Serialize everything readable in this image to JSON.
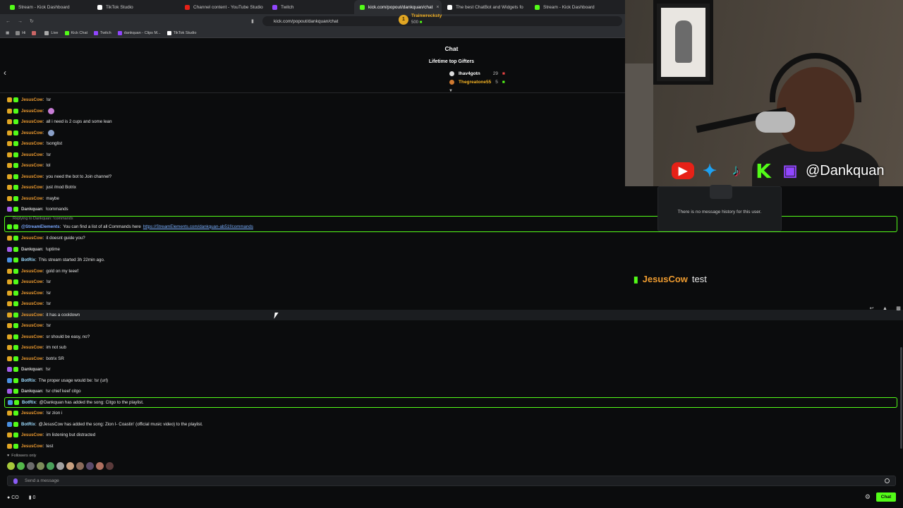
{
  "browser": {
    "tabs": [
      {
        "label": "Stream - Kick Dashboard",
        "color": "#53fc18",
        "active": false
      },
      {
        "label": "TikTok Studio",
        "color": "#ffffff",
        "active": false
      },
      {
        "label": "Channel content - YouTube Studio",
        "color": "#e62117",
        "active": false
      },
      {
        "label": "Twitch",
        "color": "#9146ff",
        "active": false
      },
      {
        "label": "kick.com/popout/dankquan/chat",
        "color": "#53fc18",
        "active": true
      },
      {
        "label": "The best ChatBot and Widgets fo",
        "color": "#ffffff",
        "active": false
      },
      {
        "label": "Stream - Kick Dashboard",
        "color": "#53fc18",
        "active": false
      }
    ],
    "url": "kick.com/popout/dankquan/chat",
    "bookmarks": [
      {
        "label": "Hi",
        "color": "#888"
      },
      {
        "label": "",
        "color": "#c66"
      },
      {
        "label": "Live",
        "color": "#aaa"
      },
      {
        "label": "Kick Chat",
        "color": "#53fc18"
      },
      {
        "label": "Twitch",
        "color": "#9146ff"
      },
      {
        "label": "dankquan - Clips M...",
        "color": "#9146ff"
      },
      {
        "label": "TikTok Studio",
        "color": "#ffffff"
      }
    ]
  },
  "chat": {
    "title": "Chat",
    "gifters_title": "Lifetime top Gifters",
    "top_gifter": {
      "rank": "1",
      "name": "Trainwrecksty",
      "count": "500"
    },
    "gifters": [
      {
        "name": "Ihav4gotn",
        "count": "29",
        "color": "#ffffff"
      },
      {
        "name": "Thegreatone55",
        "count": "5",
        "color": "#f5b324"
      }
    ],
    "reply_label": "Replying to Dankquan: !commands",
    "messages": [
      {
        "user": "JesusCow",
        "color": "#ec9a2f",
        "b1": "#e1a623",
        "b2": "#53fc18",
        "text": "!sr"
      },
      {
        "user": "JesusCow",
        "color": "#ec9a2f",
        "b1": "#e1a623",
        "b2": "#53fc18",
        "text": "",
        "emote": "#c77dd6"
      },
      {
        "user": "JesusCow",
        "color": "#ec9a2f",
        "b1": "#e1a623",
        "b2": "#53fc18",
        "text": "all i need is 2 cups and some lean"
      },
      {
        "user": "JesusCow",
        "color": "#ec9a2f",
        "b1": "#e1a623",
        "b2": "#53fc18",
        "text": "",
        "emote": "#8aa0c8"
      },
      {
        "user": "JesusCow",
        "color": "#ec9a2f",
        "b1": "#e1a623",
        "b2": "#53fc18",
        "text": "!songlist"
      },
      {
        "user": "JesusCow",
        "color": "#ec9a2f",
        "b1": "#e1a623",
        "b2": "#53fc18",
        "text": "!sr"
      },
      {
        "user": "JesusCow",
        "color": "#ec9a2f",
        "b1": "#e1a623",
        "b2": "#53fc18",
        "text": "lol"
      },
      {
        "user": "JesusCow",
        "color": "#ec9a2f",
        "b1": "#e1a623",
        "b2": "#53fc18",
        "text": "you need the bot to Join channel?"
      },
      {
        "user": "JesusCow",
        "color": "#ec9a2f",
        "b1": "#e1a623",
        "b2": "#53fc18",
        "text": "just /mod Botrix"
      },
      {
        "user": "JesusCow",
        "color": "#ec9a2f",
        "b1": "#e1a623",
        "b2": "#53fc18",
        "text": "maybe"
      },
      {
        "user": "Dankquan",
        "color": "#d0d0d0",
        "b1": "#a35ce8",
        "b2": "#53fc18",
        "text": "!commands"
      },
      {
        "user": "@StreamElements",
        "color": "#7aa8ff",
        "b1": "#53fc18",
        "b2": "#53fc18",
        "text": "You can find a list of all Commands here",
        "link": "https://StreamElements.com/dankquan-ab51f/commands",
        "reply": true
      },
      {
        "user": "JesusCow",
        "color": "#ec9a2f",
        "b1": "#e1a623",
        "b2": "#53fc18",
        "text": "it doesnt guide you?"
      },
      {
        "user": "Dankquan",
        "color": "#d0d0d0",
        "b1": "#a35ce8",
        "b2": "#53fc18",
        "text": "!uptime"
      },
      {
        "user": "BotRix",
        "color": "#9ddcff",
        "b1": "#4a90e2",
        "b2": "#53fc18",
        "text": "This stream started 3h 22min ago."
      },
      {
        "user": "JesusCow",
        "color": "#ec9a2f",
        "b1": "#e1a623",
        "b2": "#53fc18",
        "text": "gold on my teeef"
      },
      {
        "user": "JesusCow",
        "color": "#ec9a2f",
        "b1": "#e1a623",
        "b2": "#53fc18",
        "text": "!sr"
      },
      {
        "user": "JesusCow",
        "color": "#ec9a2f",
        "b1": "#e1a623",
        "b2": "#53fc18",
        "text": "!sr"
      },
      {
        "user": "JesusCow",
        "color": "#ec9a2f",
        "b1": "#e1a623",
        "b2": "#53fc18",
        "text": "!sr"
      },
      {
        "user": "JesusCow",
        "color": "#ec9a2f",
        "b1": "#e1a623",
        "b2": "#53fc18",
        "text": "it has a cooldown",
        "hover": true
      },
      {
        "user": "JesusCow",
        "color": "#ec9a2f",
        "b1": "#e1a623",
        "b2": "#53fc18",
        "text": "!sr"
      },
      {
        "user": "JesusCow",
        "color": "#ec9a2f",
        "b1": "#e1a623",
        "b2": "#53fc18",
        "text": "sr should be easy, no?"
      },
      {
        "user": "JesusCow",
        "color": "#ec9a2f",
        "b1": "#e1a623",
        "b2": "#53fc18",
        "text": "im not sub"
      },
      {
        "user": "JesusCow",
        "color": "#ec9a2f",
        "b1": "#e1a623",
        "b2": "#53fc18",
        "text": "botrix SR"
      },
      {
        "user": "Dankquan",
        "color": "#d0d0d0",
        "b1": "#a35ce8",
        "b2": "#53fc18",
        "text": "!sr"
      },
      {
        "user": "BotRix",
        "color": "#9ddcff",
        "b1": "#4a90e2",
        "b2": "#53fc18",
        "text": "The proper usage would be: !sr (url)"
      },
      {
        "user": "Dankquan",
        "color": "#d0d0d0",
        "b1": "#a35ce8",
        "b2": "#53fc18",
        "text": "!sr chief keef citgo"
      },
      {
        "user": "BotRix",
        "color": "#9ddcff",
        "b1": "#4a90e2",
        "b2": "#53fc18",
        "text": "@Dankquan has added the song: Citgo to the playlist.",
        "highlight": true
      },
      {
        "user": "JesusCow",
        "color": "#ec9a2f",
        "b1": "#e1a623",
        "b2": "#53fc18",
        "text": "!sr zion i"
      },
      {
        "user": "BotRix",
        "color": "#9ddcff",
        "b1": "#4a90e2",
        "b2": "#53fc18",
        "text": "@JesusCow has added the song: Zion I- Coastin' (official music video) to the playlist."
      },
      {
        "user": "JesusCow",
        "color": "#ec9a2f",
        "b1": "#e1a623",
        "b2": "#53fc18",
        "text": "im listening but distracted"
      },
      {
        "user": "JesusCow",
        "color": "#ec9a2f",
        "b1": "#e1a623",
        "b2": "#53fc18",
        "text": "test"
      }
    ],
    "history_text": "There is no message history for this user.",
    "overlay": {
      "user": "JesusCow",
      "text": "test"
    },
    "followers_only": "Followers only",
    "input_placeholder": "Send a message",
    "viewers": "CO",
    "count": "0",
    "chat_button": "Chat"
  },
  "webcam": {
    "handle": "@Dankquan",
    "socials": [
      "youtube-icon",
      "twitter-icon",
      "tiktok-icon",
      "kick-icon",
      "twitch-icon"
    ]
  },
  "emote_colors": [
    "#a6c83a",
    "#53b84a",
    "#6b6b6b",
    "#7d8c5a",
    "#49a05a",
    "#a0a0a0",
    "#c8a080",
    "#8a6a5a",
    "#5a4a6a",
    "#b07060",
    "#5a3a3a"
  ]
}
